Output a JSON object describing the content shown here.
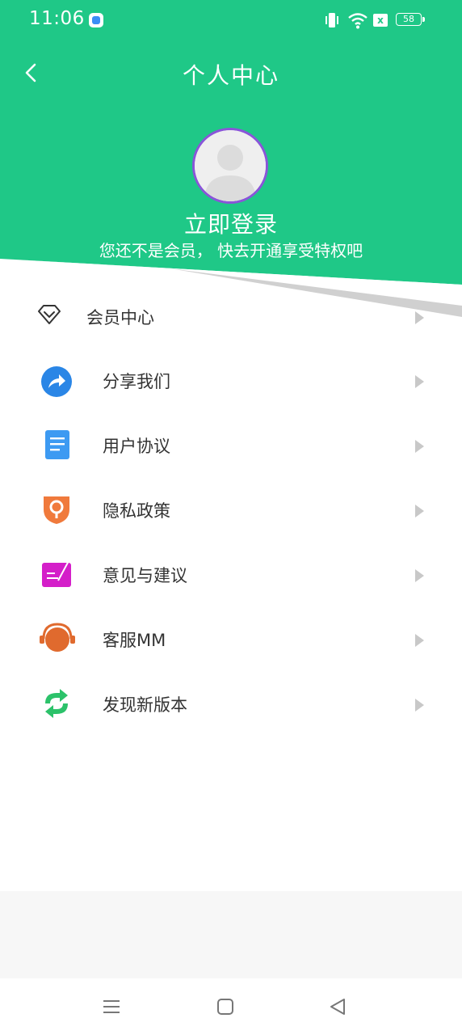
{
  "status_bar": {
    "time": "11:06",
    "battery": "58",
    "sim_label": "x"
  },
  "header": {
    "title": "个人中心",
    "login_text": "立即登录",
    "member_tip": "您还不是会员， 快去开通享受特权吧",
    "accent_color": "#1fc887",
    "avatar_border_color": "#8a55d9"
  },
  "menu": {
    "items": [
      {
        "label": "会员中心",
        "icon": "diamond-icon"
      },
      {
        "label": "分享我们",
        "icon": "share-icon"
      },
      {
        "label": "用户协议",
        "icon": "document-icon"
      },
      {
        "label": "隐私政策",
        "icon": "privacy-shield-icon"
      },
      {
        "label": "意见与建议",
        "icon": "feedback-icon"
      },
      {
        "label": "客服MM",
        "icon": "headset-icon"
      },
      {
        "label": "发现新版本",
        "icon": "refresh-icon"
      }
    ]
  },
  "nav_bar": {
    "buttons": [
      "menu-icon",
      "home-icon",
      "back-triangle-icon"
    ]
  }
}
